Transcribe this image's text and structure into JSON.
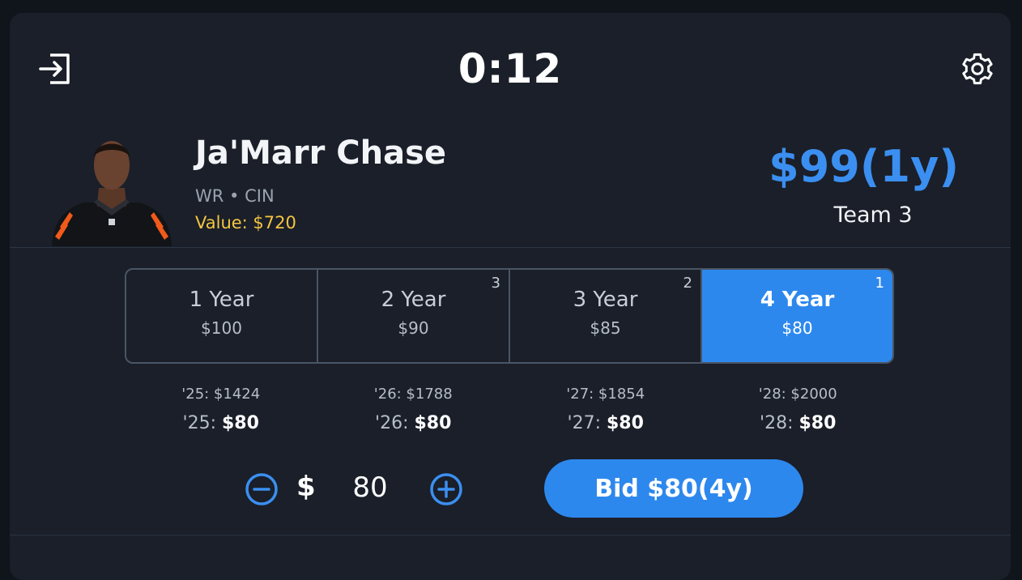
{
  "header": {
    "timer": "0:12",
    "exit_icon": "exit-icon",
    "settings_icon": "gear-icon"
  },
  "player": {
    "name": "Ja'Marr Chase",
    "meta": "WR • CIN",
    "value": "Value: $720",
    "photo_icon": "player-headshot"
  },
  "current_bid": {
    "amount": "$99(1y)",
    "team": "Team 3"
  },
  "terms": [
    {
      "label": "1 Year",
      "price": "$100",
      "rank": "",
      "selected": false
    },
    {
      "label": "2 Year",
      "price": "$90",
      "rank": "3",
      "selected": false
    },
    {
      "label": "3 Year",
      "price": "$85",
      "rank": "2",
      "selected": false
    },
    {
      "label": "4 Year",
      "price": "$80",
      "rank": "1",
      "selected": true
    }
  ],
  "projections": [
    {
      "value": "'25:  $1424",
      "bid_year": "'25: ",
      "bid_amount": "$80"
    },
    {
      "value": "'26:  $1788",
      "bid_year": "'26: ",
      "bid_amount": "$80"
    },
    {
      "value": "'27:  $1854",
      "bid_year": "'27: ",
      "bid_amount": "$80"
    },
    {
      "value": "'28:  $2000",
      "bid_year": "'28: ",
      "bid_amount": "$80"
    }
  ],
  "bid_controls": {
    "currency": "$",
    "amount": "80",
    "minus_icon": "minus-circle-icon",
    "plus_icon": "plus-circle-icon",
    "bid_button": "Bid $80(4y)"
  },
  "colors": {
    "accent": "#2d88ed",
    "value_highlight": "#f5c542",
    "background": "#1a1f29"
  }
}
